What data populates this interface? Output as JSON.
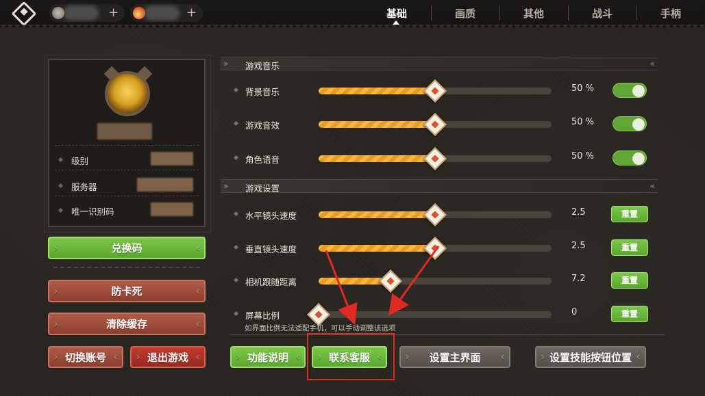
{
  "tabs": [
    {
      "label": "基础",
      "active": true
    },
    {
      "label": "画质",
      "active": false
    },
    {
      "label": "其他",
      "active": false
    },
    {
      "label": "战斗",
      "active": false
    },
    {
      "label": "手柄",
      "active": false
    }
  ],
  "topbar": {
    "plus_symbol": "+"
  },
  "profile": {
    "rows": [
      {
        "label": "级别"
      },
      {
        "label": "服务器"
      },
      {
        "label": "唯一识别码"
      }
    ]
  },
  "left_buttons": {
    "redeem": "兑换码",
    "anti_stuck": "防卡死",
    "clear_cache": "清除缓存",
    "switch_account": "切换账号",
    "exit_game": "退出游戏"
  },
  "sections": {
    "audio": {
      "title": "游戏音乐",
      "rows": [
        {
          "label": "背景音乐",
          "value": "50 %",
          "level": 0.5,
          "enabled": true
        },
        {
          "label": "游戏音效",
          "value": "50 %",
          "level": 0.5,
          "enabled": true
        },
        {
          "label": "角色语音",
          "value": "50 %",
          "level": 0.5,
          "enabled": true
        }
      ]
    },
    "game": {
      "title": "游戏设置",
      "reset_label": "重置",
      "rows": [
        {
          "label": "水平镜头速度",
          "value": "2.5",
          "level": 0.5
        },
        {
          "label": "垂直镜头速度",
          "value": "2.5",
          "level": 0.5
        },
        {
          "label": "相机跟随距离",
          "value": "7.2",
          "level": 0.31
        },
        {
          "label": "屏幕比例",
          "value": "0",
          "level": 0.0
        }
      ],
      "hint": "如界面比例无法适配手机，可以手动调整该选项"
    }
  },
  "bottom_buttons": {
    "function_help": "功能说明",
    "contact_support": "联系客服",
    "set_main_ui": "设置主界面",
    "set_skill_buttons": "设置技能按钮位置"
  },
  "colors": {
    "accent_green": "#6bb83c",
    "slider_orange": "#f0a830",
    "annotation_red": "#e02a24"
  }
}
